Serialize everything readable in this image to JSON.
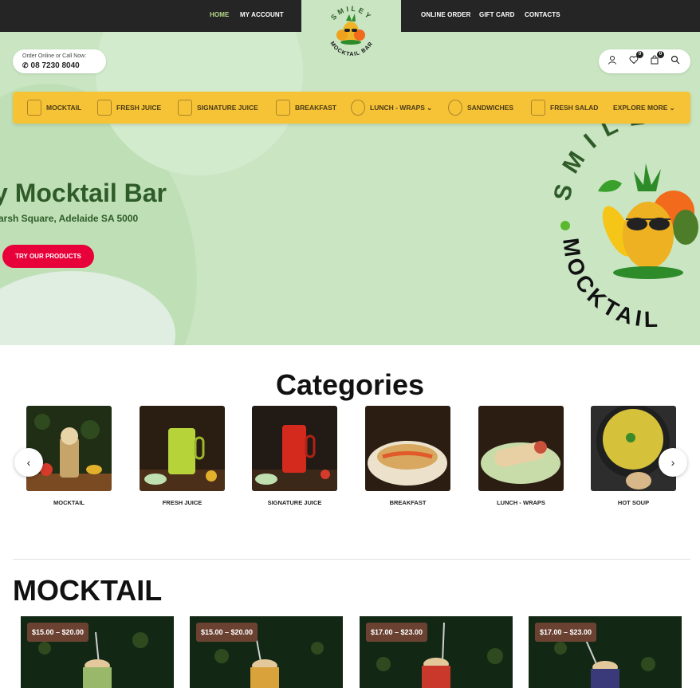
{
  "topnav": {
    "home": "HOME",
    "my_account": "MY ACCOUNT",
    "online_order": "ONLINE ORDER",
    "gift_card": "GIFT CARD",
    "contacts": "CONTACTS"
  },
  "logo": {
    "top_text": "SMILEY",
    "bottom_text": "MOCKTAIL BAR"
  },
  "call": {
    "label": "Order Online or Call Now:",
    "phone": "08 7230 8040"
  },
  "header_icons": {
    "wishlist_count": "0",
    "cart_count": "0"
  },
  "catnav": [
    {
      "label": "MOCKTAIL",
      "icon": "glass-icon"
    },
    {
      "label": "FRESH JUICE",
      "icon": "juice-icon"
    },
    {
      "label": "SIGNATURE JUICE",
      "icon": "cup-icon"
    },
    {
      "label": "BREAKFAST",
      "icon": "breakfast-icon"
    },
    {
      "label": "LUNCH - WRAPS",
      "icon": "wrap-icon"
    },
    {
      "label": "SANDWICHES",
      "icon": "sandwich-icon"
    },
    {
      "label": "FRESH SALAD",
      "icon": "salad-icon"
    },
    {
      "label": "EXPLORE MORE",
      "icon": "chevron-down-icon"
    }
  ],
  "hero": {
    "title": "y Mocktail Bar",
    "address": "arsh Square, Adelaide SA 5000",
    "button": "TRY OUR PRODUCTS",
    "badge_top": "SMILE",
    "badge_bottom": "MOCKTAIL"
  },
  "categories": {
    "title": "Categories",
    "items": [
      {
        "label": "MOCKTAIL"
      },
      {
        "label": "FRESH JUICE"
      },
      {
        "label": "SIGNATURE JUICE"
      },
      {
        "label": "BREAKFAST"
      },
      {
        "label": "LUNCH - WRAPS"
      },
      {
        "label": "HOT SOUP"
      }
    ]
  },
  "mocktail": {
    "title": "MOCKTAIL",
    "products": [
      {
        "price": "$15.00 – $20.00"
      },
      {
        "price": "$15.00 – $20.00"
      },
      {
        "price": "$17.00 – $23.00"
      },
      {
        "price": "$17.00 – $23.00"
      }
    ]
  },
  "colors": {
    "topbar": "#252525",
    "hero_bg": "#c9e5c2",
    "catnav_bg": "#f6c337",
    "accent_red": "#e8003a",
    "hero_text": "#2e5b28",
    "price_tag": "#6b4232"
  }
}
